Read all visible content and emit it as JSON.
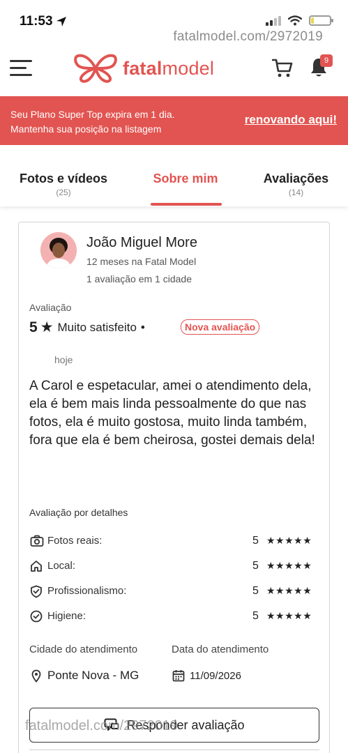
{
  "status_bar": {
    "time": "11:53",
    "battery_level": 0.15
  },
  "watermark": "fatalmodel.com/2972019",
  "header": {
    "logo_part1": "fatal",
    "logo_part2": "model",
    "notification_count": "9",
    "brand_color": "#e25451"
  },
  "banner": {
    "line1": "Seu Plano Super Top expira em 1 dia.",
    "line2": "Mantenha sua posição na listagem",
    "link": "renovando aqui!"
  },
  "tabs": [
    {
      "label": "Fotos e vídeos",
      "count": "(25)"
    },
    {
      "label": "Sobre mim",
      "count": ""
    },
    {
      "label": "Avaliações",
      "count": "(14)"
    }
  ],
  "review": {
    "user_name": "João Miguel More",
    "tenure": "12 meses na Fatal Model",
    "reviews_count": "1 avaliação em 1 cidade",
    "rating_label": "Avaliação",
    "rating_value": "5",
    "satisfaction": "Muito satisfeito",
    "separator": "•",
    "badge": "Nova avaliação",
    "date": "hoje",
    "text": "A Carol e espetacular, amei o atendimento dela, ela é bem mais linda pessoalmente do que nas fotos, ela é muito gostosa, muito linda também, fora que ela é bem cheirosa, gostei demais dela!",
    "details_label": "Avaliação por detalhes",
    "details": [
      {
        "label": "Fotos reais:",
        "score": "5",
        "stars": "★★★★★",
        "icon": "camera-check-icon"
      },
      {
        "label": "Local:",
        "score": "5",
        "stars": "★★★★★",
        "icon": "home-icon"
      },
      {
        "label": "Profissionalismo:",
        "score": "5",
        "stars": "★★★★★",
        "icon": "shield-check-icon"
      },
      {
        "label": "Higiene:",
        "score": "5",
        "stars": "★★★★★",
        "icon": "check-circle-icon"
      }
    ],
    "city_label": "Cidade do atendimento",
    "date_label": "Data do atendimento",
    "city_value": "Ponte Nova - MG",
    "date_value": "11/09/2026",
    "reply_button": "Responder avaliação"
  }
}
